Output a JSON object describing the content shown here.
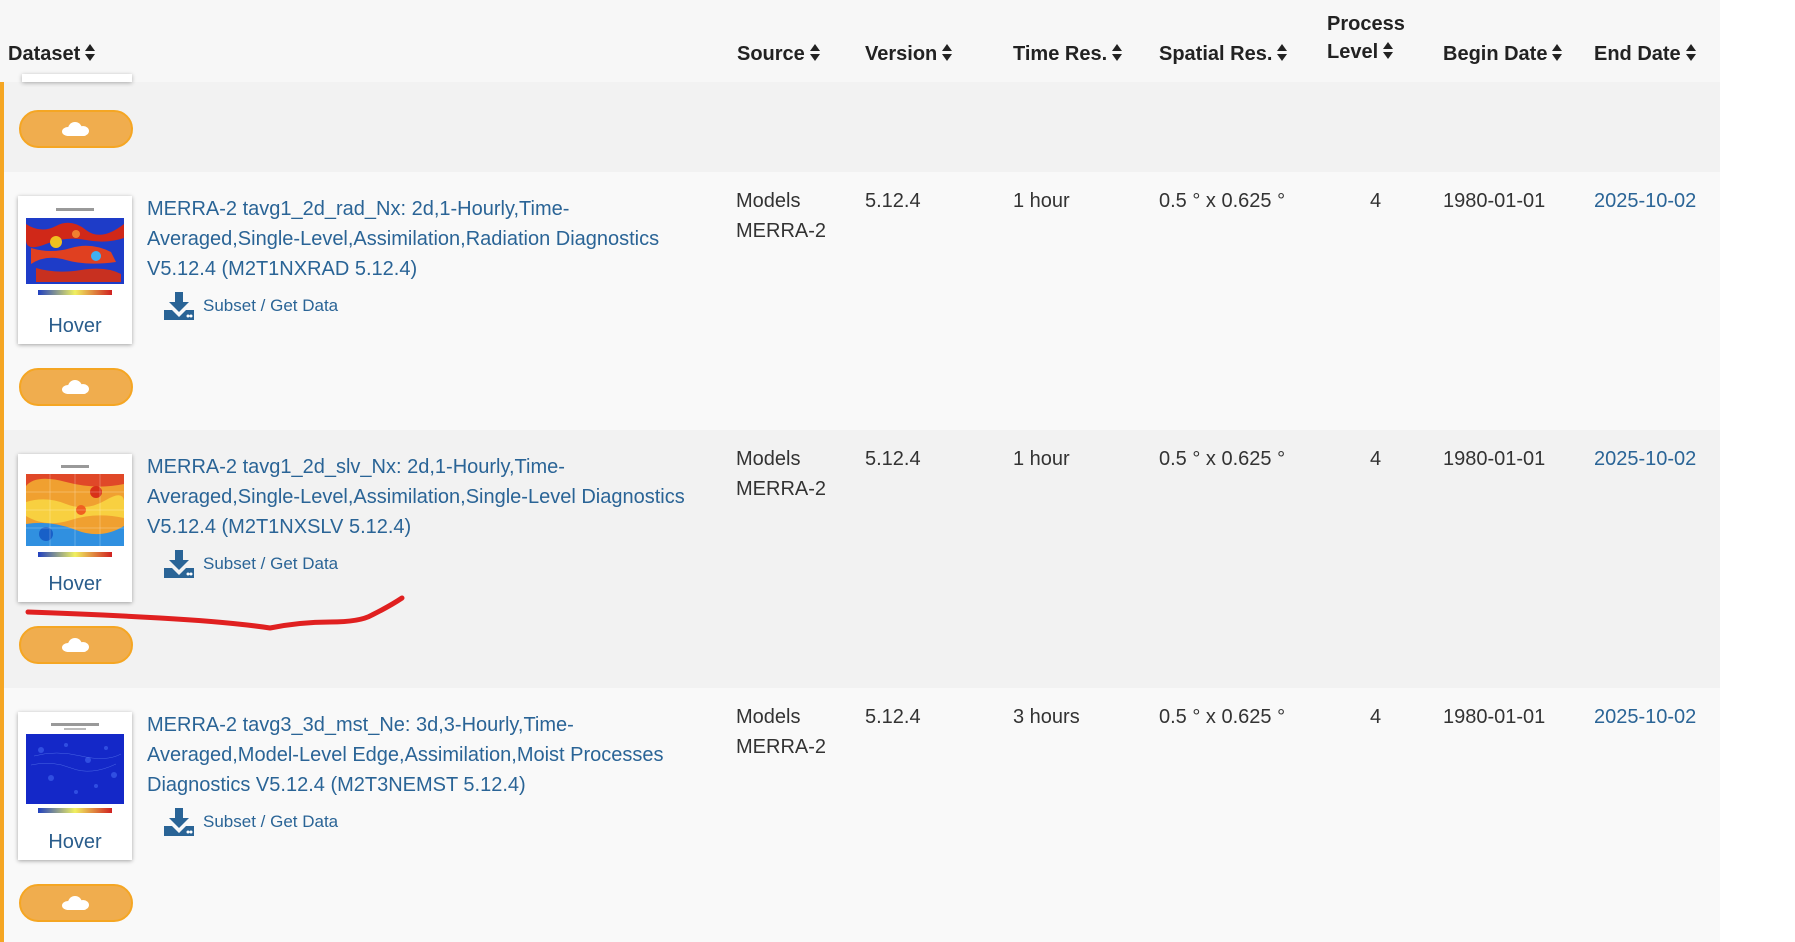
{
  "header": {
    "dataset": "Dataset",
    "source": "Source",
    "version": "Version",
    "time_res": "Time Res.",
    "spatial_res": "Spatial Res.",
    "process_level_1": "Process",
    "process_level_2": "Level",
    "begin_date": "Begin Date",
    "end_date": "End Date"
  },
  "rows": [
    {
      "title": "MERRA-2 tavg1_2d_rad_Nx: 2d,1-Hourly,Time-Averaged,Single-Level,Assimilation,Radiation Diagnostics V5.12.4 (M2T1NXRAD 5.12.4)",
      "subset_label": "Subset / Get Data",
      "thumb_label": "Hover",
      "source_1": "Models",
      "source_2": "MERRA-2",
      "version": "5.12.4",
      "time_res": "1 hour",
      "spatial_res": "0.5 ° x 0.625 °",
      "process_level": "4",
      "begin_date": "1980-01-01",
      "end_date": "2025-10-02"
    },
    {
      "title": "MERRA-2 tavg1_2d_slv_Nx: 2d,1-Hourly,Time-Averaged,Single-Level,Assimilation,Single-Level Diagnostics V5.12.4 (M2T1NXSLV 5.12.4)",
      "subset_label": "Subset / Get Data",
      "thumb_label": "Hover",
      "source_1": "Models",
      "source_2": "MERRA-2",
      "version": "5.12.4",
      "time_res": "1 hour",
      "spatial_res": "0.5 ° x 0.625 °",
      "process_level": "4",
      "begin_date": "1980-01-01",
      "end_date": "2025-10-02"
    },
    {
      "title": "MERRA-2 tavg3_3d_mst_Ne: 3d,3-Hourly,Time-Averaged,Model-Level Edge,Assimilation,Moist Processes Diagnostics V5.12.4 (M2T3NEMST 5.12.4)",
      "subset_label": "Subset / Get Data",
      "thumb_label": "Hover",
      "source_1": "Models",
      "source_2": "MERRA-2",
      "version": "5.12.4",
      "time_res": "3 hours",
      "spatial_res": "0.5 ° x 0.625 °",
      "process_level": "4",
      "begin_date": "1980-01-01",
      "end_date": "2025-10-02"
    }
  ],
  "colors": {
    "accent": "#f5a623",
    "link": "#2a6496",
    "annotation": "#e02020"
  }
}
